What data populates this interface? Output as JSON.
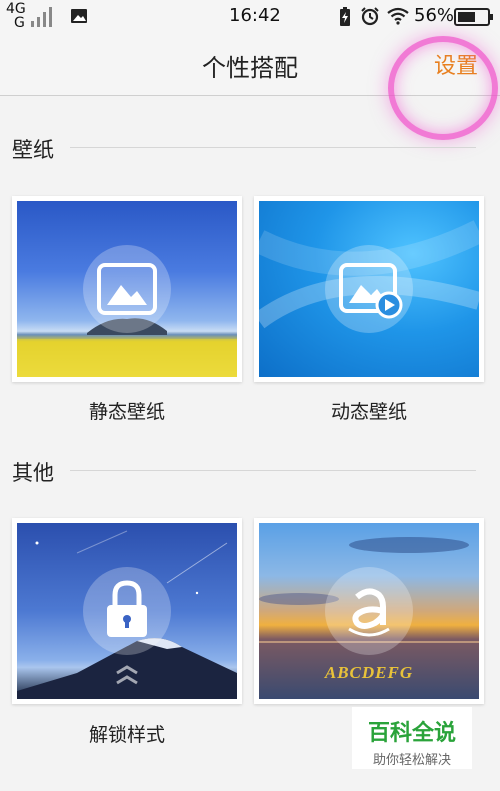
{
  "status_bar": {
    "network": "4G",
    "network2": "G",
    "time": "16:42",
    "battery": "56%"
  },
  "header": {
    "title": "个性搭配",
    "settings": "设置"
  },
  "sections": {
    "wallpaper": {
      "title": "壁纸",
      "static_label": "静态壁纸",
      "dynamic_label": "动态壁纸"
    },
    "other": {
      "title": "其他",
      "lock_label": "解锁样式",
      "font_sample": "ABCDEFG"
    }
  },
  "watermark": {
    "title": "百科全说",
    "subtitle": "助你轻松解决"
  },
  "colors": {
    "accent": "#e88020",
    "highlight_ring": "#f046c8",
    "watermark_green": "#2aa33a"
  }
}
